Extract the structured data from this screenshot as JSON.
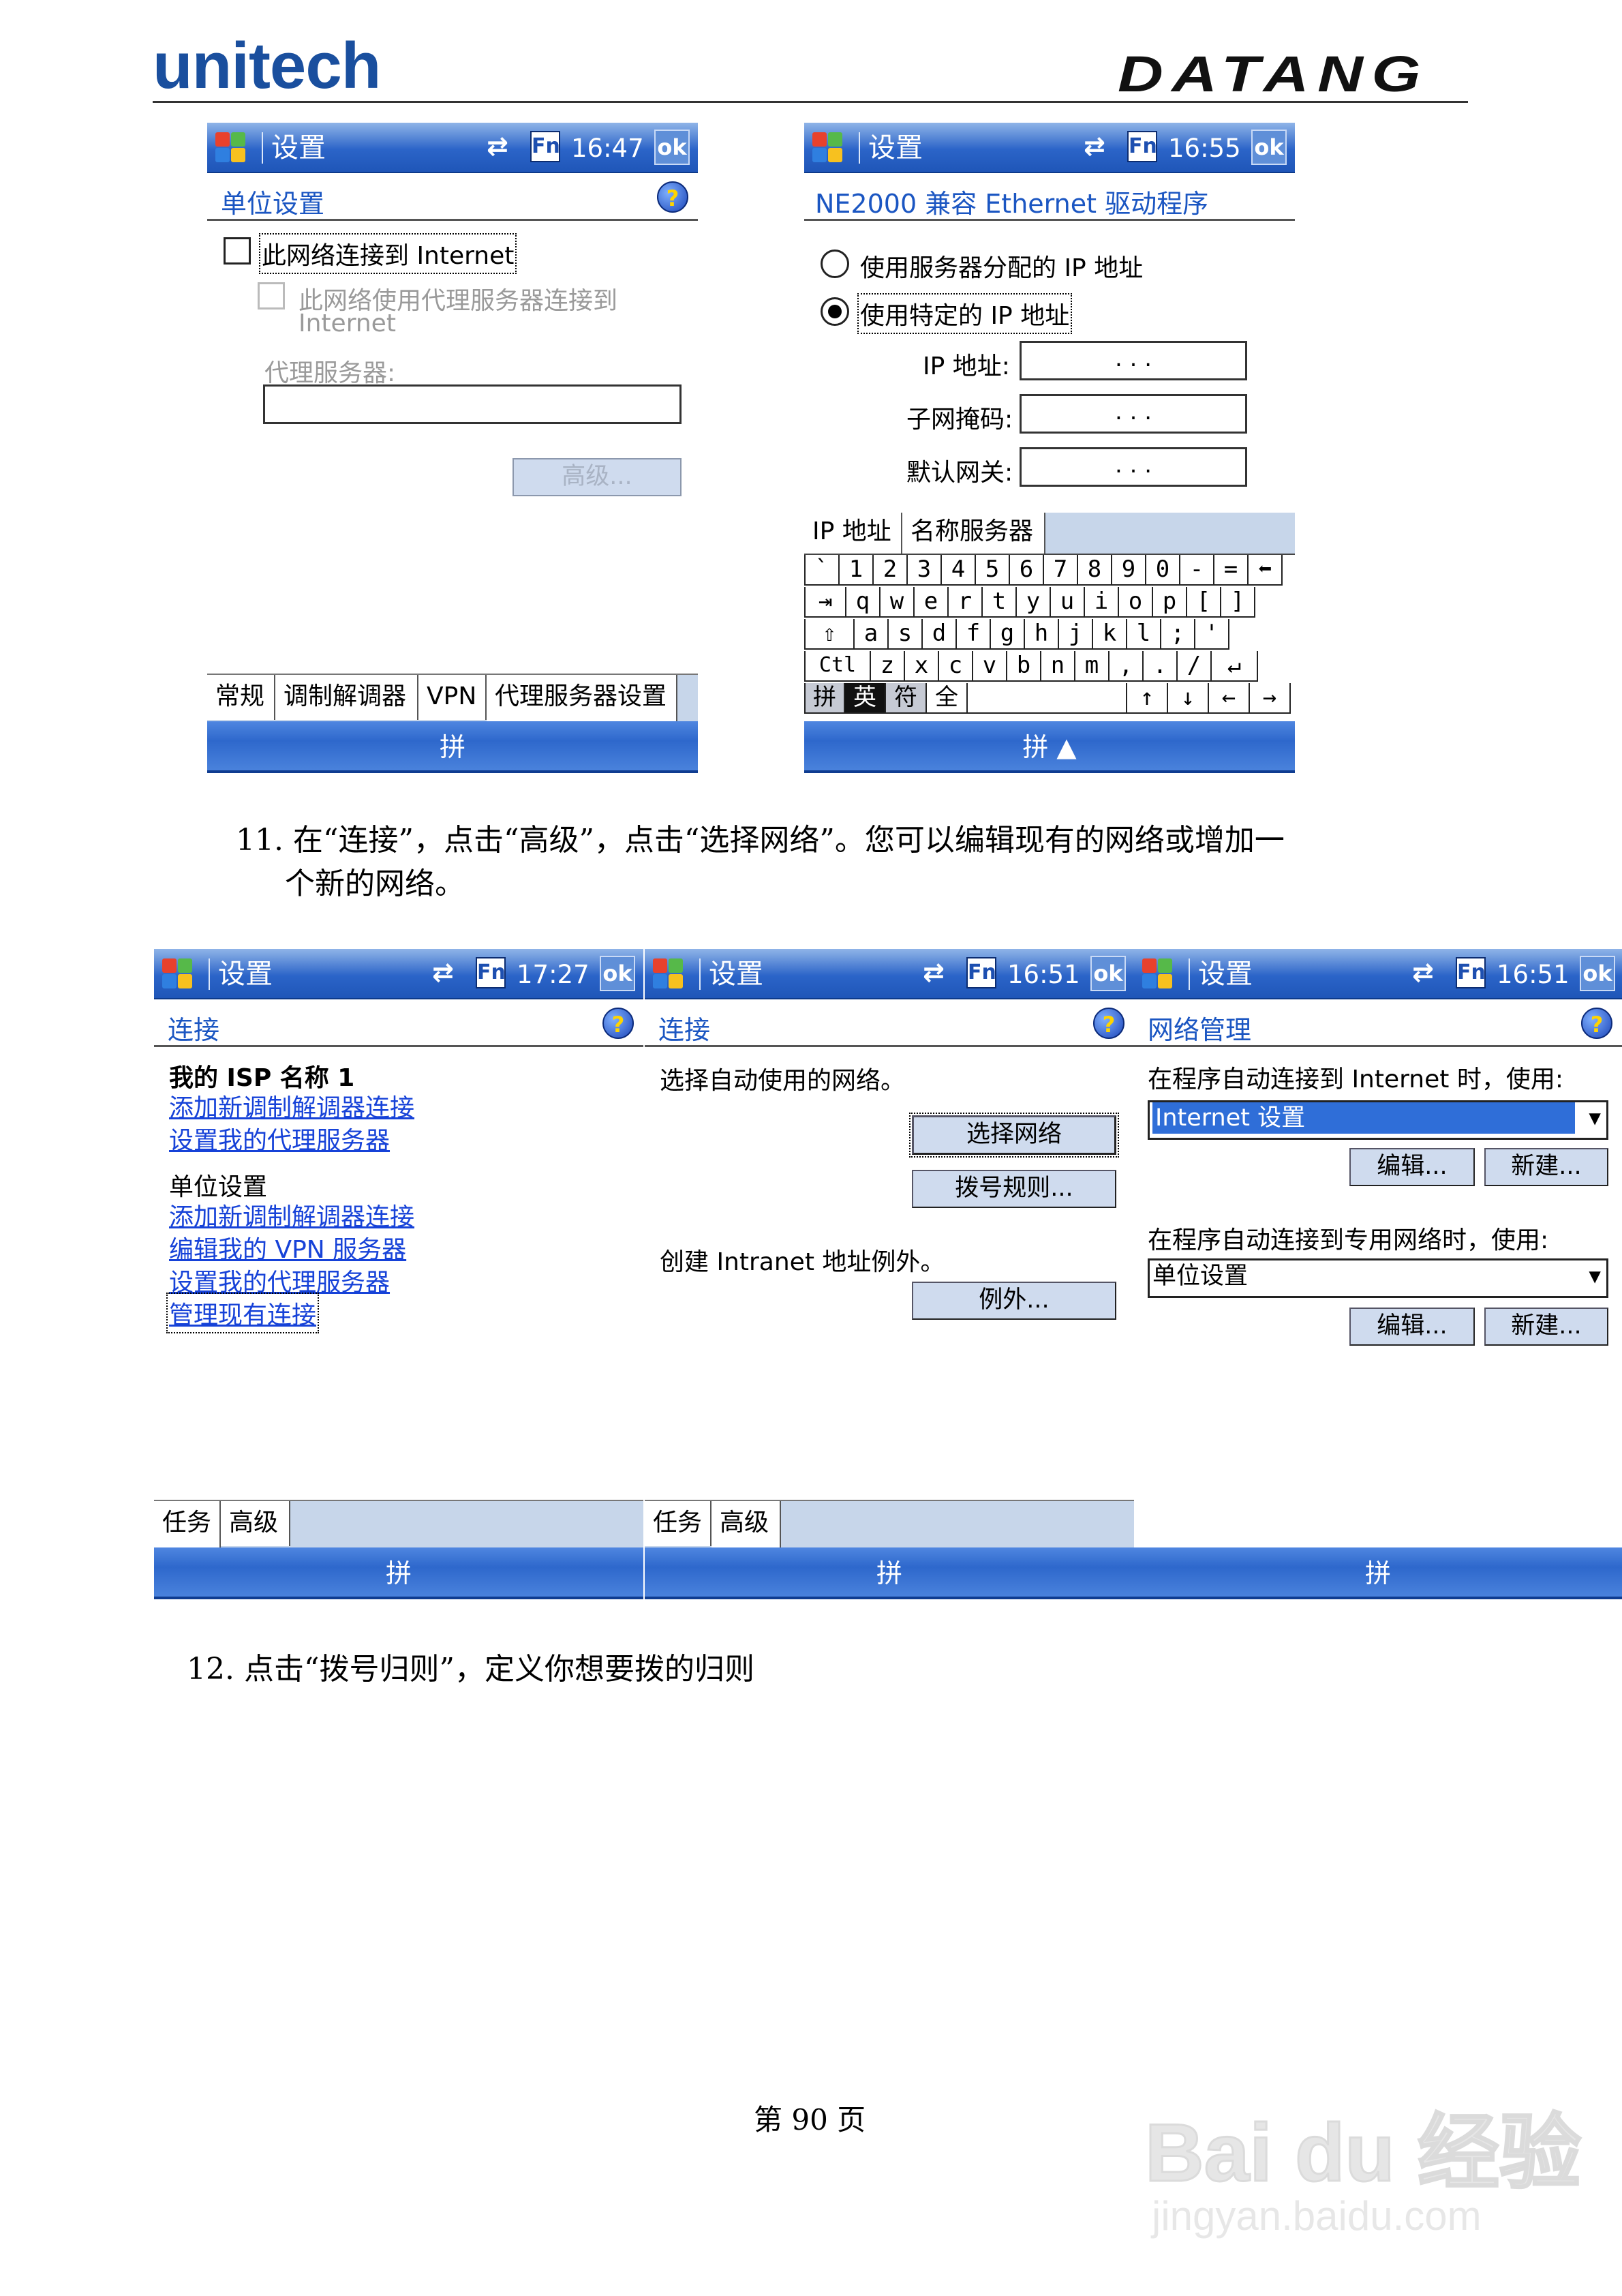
{
  "header": {
    "logo_left": "unitech",
    "logo_right": "DATANG"
  },
  "screens": {
    "s1": {
      "title": "设置",
      "time": "16:47",
      "fn": "Fn",
      "ok": "ok",
      "heading": "单位设置",
      "help": "?",
      "chk1": "此网络连接到 Internet",
      "chk2_line1": "此网络使用代理服务器连接到",
      "chk2_line2": "Internet",
      "proxy_label": "代理服务器:",
      "advanced_btn": "高级...",
      "tabs": [
        "常规",
        "调制解调器",
        "VPN",
        "代理服务器设置"
      ],
      "sip": "拼"
    },
    "s2": {
      "title": "设置",
      "time": "16:55",
      "fn": "Fn",
      "ok": "ok",
      "heading": "NE2000 兼容 Ethernet 驱动程序",
      "radio1": "使用服务器分配的 IP 地址",
      "radio2": "使用特定的 IP 地址",
      "ip_label": "IP 地址:",
      "mask_label": "子网掩码:",
      "gw_label": "默认网关:",
      "ip_dots": ".      .      .",
      "tabs": [
        "IP 地址",
        "名称服务器"
      ],
      "sip": "拼 ▲",
      "keyboard": {
        "row1": [
          "`",
          "1",
          "2",
          "3",
          "4",
          "5",
          "6",
          "7",
          "8",
          "9",
          "0",
          "-",
          "=",
          "⬅"
        ],
        "row2": [
          "⇥",
          "q",
          "w",
          "e",
          "r",
          "t",
          "y",
          "u",
          "i",
          "o",
          "p",
          "[",
          "]"
        ],
        "row3": [
          "⇧",
          "a",
          "s",
          "d",
          "f",
          "g",
          "h",
          "j",
          "k",
          "l",
          ";",
          "'"
        ],
        "row4": [
          "Ctl",
          "z",
          "x",
          "c",
          "v",
          "b",
          "n",
          "m",
          ",",
          ".",
          "/",
          "↵"
        ],
        "row5": [
          "拼",
          "英",
          "符",
          "全",
          "",
          "↑",
          "↓",
          "←",
          "→"
        ]
      }
    },
    "s3": {
      "title": "设置",
      "time": "17:27",
      "fn": "Fn",
      "ok": "ok",
      "heading": "连接",
      "help": "?",
      "isp_title": "我的 ISP 名称 1",
      "isp_link1": "添加新调制解调器连接",
      "isp_link2": "设置我的代理服务器",
      "work_title": "单位设置",
      "work_link1": "添加新调制解调器连接",
      "work_link2": "编辑我的 VPN 服务器",
      "work_link3": "设置我的代理服务器",
      "work_link4": "管理现有连接",
      "tabs": [
        "任务",
        "高级"
      ],
      "sip": "拼"
    },
    "s4": {
      "title": "设置",
      "time": "16:51",
      "fn": "Fn",
      "ok": "ok",
      "heading": "连接",
      "help": "?",
      "auto_text": "选择自动使用的网络。",
      "btn_select": "选择网络",
      "btn_dial": "拨号规则...",
      "intranet_text": "创建 Intranet 地址例外。",
      "btn_except": "例外...",
      "tabs": [
        "任务",
        "高级"
      ],
      "sip": "拼"
    },
    "s5": {
      "title": "设置",
      "time": "16:51",
      "fn": "Fn",
      "ok": "ok",
      "heading": "网络管理",
      "help": "?",
      "label1": "在程序自动连接到 Internet 时，使用:",
      "select1": "Internet 设置",
      "edit1": "编辑...",
      "new1": "新建...",
      "label2": "在程序自动连接到专用网络时，使用:",
      "select2": "单位设置",
      "edit2": "编辑...",
      "new2": "新建...",
      "sip": "拼"
    }
  },
  "captions": {
    "step11_line1": "11. 在“连接”，点击“高级”，点击“选择网络”。您可以编辑现有的网络或增加一",
    "step11_line2": "个新的网络。",
    "step12": "12. 点击“拨号归则”，定义你想要拨的归则"
  },
  "footer": {
    "page": "第 90 页"
  },
  "watermark": {
    "brand": "Bai du 经验",
    "url": "jingyan.baidu.com"
  }
}
